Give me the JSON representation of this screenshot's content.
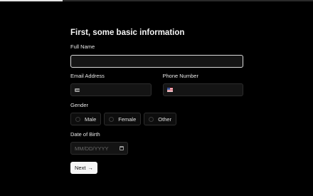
{
  "progress": {
    "value": 0.2
  },
  "form": {
    "title": "First, some basic information",
    "full_name": {
      "label": "Full Name",
      "value": "",
      "placeholder": ""
    },
    "email": {
      "label": "Email Address",
      "value": "",
      "placeholder": "",
      "icon": "envelope-icon"
    },
    "phone": {
      "label": "Phone Number",
      "value": "",
      "placeholder": "",
      "icon": "us-flag-icon"
    },
    "gender": {
      "label": "Gender",
      "options": [
        "Male",
        "Female",
        "Other"
      ]
    },
    "dob": {
      "label": "Date of Birth",
      "placeholder": "MM/DD/YYYY",
      "icon": "calendar-icon"
    },
    "next_label": "Next",
    "next_arrow": "→"
  },
  "colors": {
    "background": "#000000",
    "input_bg": "#141414",
    "input_border": "#2c2c2c",
    "focus_border": "#d9d9d9",
    "button_bg": "#f5f5f5"
  }
}
